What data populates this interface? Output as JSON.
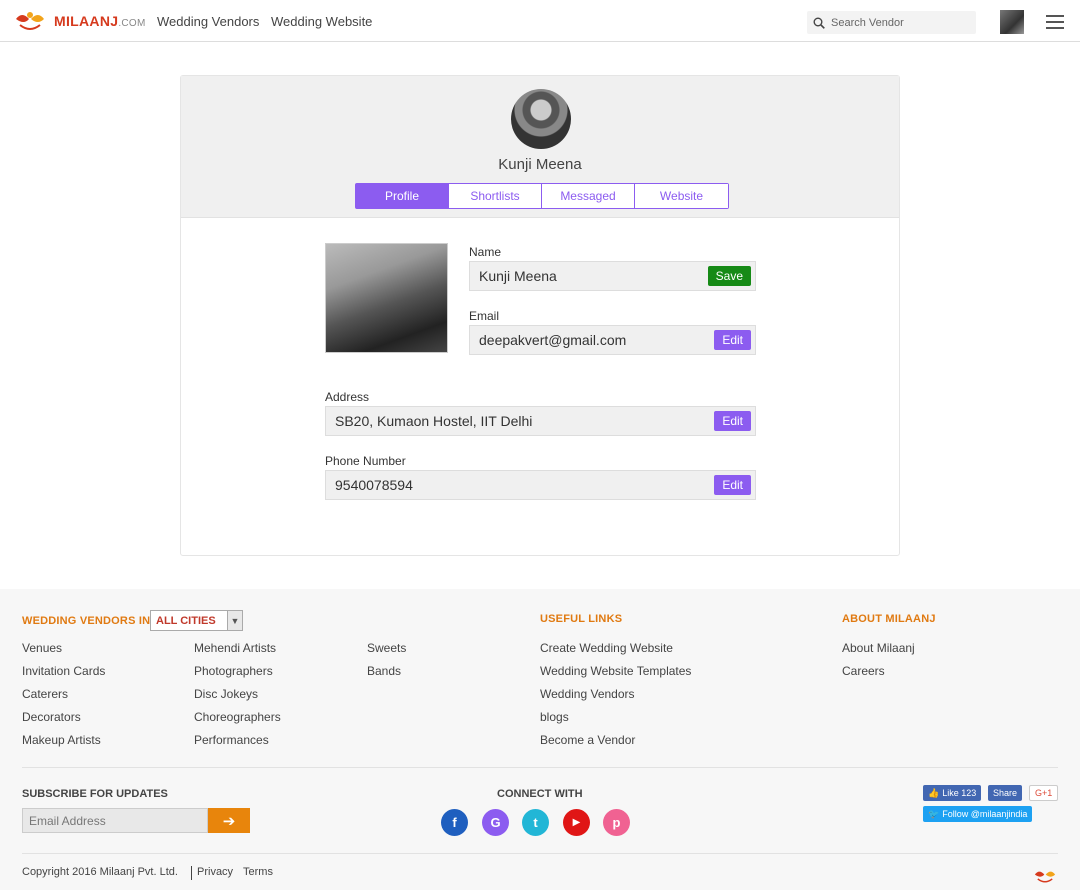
{
  "header": {
    "logo_text": "MILAANJ",
    "logo_suffix": ".COM",
    "nav": [
      "Wedding Vendors",
      "Wedding Website"
    ],
    "search_placeholder": "Search Vendor"
  },
  "profile": {
    "name": "Kunji Meena",
    "tabs": [
      "Profile",
      "Shortlists",
      "Messaged",
      "Website"
    ],
    "active_tab": "Profile",
    "fields": {
      "name": {
        "label": "Name",
        "value": "Kunji Meena",
        "button": "Save"
      },
      "email": {
        "label": "Email",
        "value": "deepakvert@gmail.com",
        "button": "Edit"
      },
      "address": {
        "label": "Address",
        "value": "SB20, Kumaon Hostel, IIT Delhi",
        "button": "Edit"
      },
      "phone": {
        "label": "Phone Number",
        "value": "9540078594",
        "button": "Edit"
      }
    }
  },
  "footer": {
    "vendors_heading": "WEDDING VENDORS IN",
    "city_select": "ALL CITIES",
    "vendor_col1": [
      "Venues",
      "Invitation Cards",
      "Caterers",
      "Decorators",
      "Makeup Artists"
    ],
    "vendor_col2": [
      "Mehendi Artists",
      "Photographers",
      "Disc Jokeys",
      "Choreographers",
      "Performances"
    ],
    "vendor_col3": [
      "Sweets",
      "Bands"
    ],
    "useful_heading": "USEFUL LINKS",
    "useful_links": [
      "Create Wedding Website",
      "Wedding Website Templates",
      "Wedding Vendors",
      "blogs",
      "Become a Vendor"
    ],
    "about_heading": "ABOUT MILAANJ",
    "about_links": [
      "About Milaanj",
      "Careers"
    ],
    "subscribe_heading": "SUBSCRIBE FOR UPDATES",
    "email_placeholder": "Email Address",
    "connect_heading": "CONNECT WITH",
    "social": [
      {
        "name": "facebook",
        "glyph": "f",
        "color": "#1f5fbf"
      },
      {
        "name": "google-plus",
        "glyph": "G",
        "color": "#8c5cf0"
      },
      {
        "name": "twitter",
        "glyph": "t",
        "color": "#22b6d6"
      },
      {
        "name": "youtube",
        "glyph": "▶",
        "color": "#e01616"
      },
      {
        "name": "pinterest",
        "glyph": "p",
        "color": "#f06292"
      }
    ],
    "fb_like": "Like 123",
    "fb_share": "Share",
    "gplus": "G+1",
    "twitter_follow": "Follow @milaanjindia",
    "copyright": "Copyright 2016 Milaanj Pvt. Ltd.",
    "privacy": "Privacy",
    "terms": "Terms"
  }
}
